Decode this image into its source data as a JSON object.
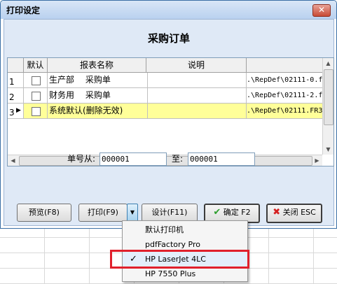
{
  "dialog": {
    "title": "打印设定",
    "close_glyph": "✕",
    "report_title": "采购订单"
  },
  "table": {
    "columns": [
      "默认",
      "报表名称",
      "说明"
    ],
    "rows": [
      {
        "num": "1",
        "name": "生产部　 采购单",
        "desc": "",
        "path": ".\\RepDef\\02111-0.f",
        "checked": false,
        "selected": false
      },
      {
        "num": "2",
        "name": "财务用　 采购单",
        "desc": "",
        "path": ".\\RepDef\\02111-2.f",
        "checked": false,
        "selected": false
      },
      {
        "num": "3",
        "name": "系统默认(删除无效)",
        "desc": "",
        "path": ".\\RepDef\\02111.FR3",
        "checked": false,
        "selected": true
      }
    ]
  },
  "range": {
    "from_label": "单号从:",
    "from_value": "000001",
    "to_label": "至:",
    "to_value": "000001"
  },
  "buttons": {
    "preview": "预览(F8)",
    "print": "打印(F9)",
    "design": "设计(F11)",
    "ok": "确定 F2",
    "close": "关闭 ESC"
  },
  "printer_menu": {
    "items": [
      {
        "label": "默认打印机",
        "checked": false
      },
      {
        "label": "pdfFactory Pro",
        "checked": false
      },
      {
        "label": "HP LaserJet 4LC",
        "checked": true
      },
      {
        "label": "HP 7550 Plus",
        "checked": false
      }
    ]
  },
  "colors": {
    "selected_row": "#ffff99",
    "annotation_box": "#e0202c",
    "ok_icon": "#2e9e2e",
    "close_icon": "#d42020"
  }
}
